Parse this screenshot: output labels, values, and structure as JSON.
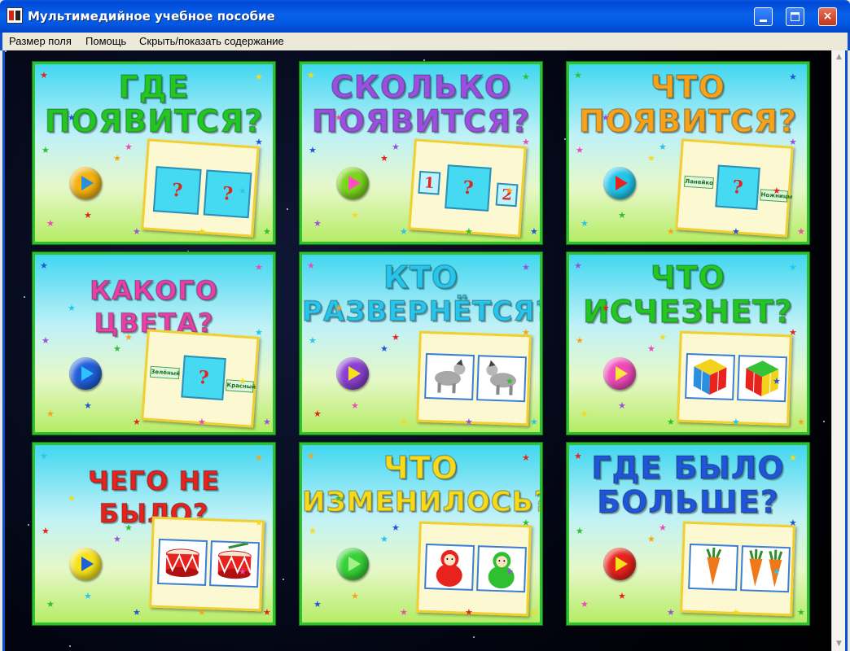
{
  "window": {
    "title": "Мультимедийное учебное пособие",
    "minimize_glyph": "",
    "maximize_glyph": "",
    "close_glyph": "×"
  },
  "menu": {
    "items": [
      "Размер поля",
      "Помощь",
      "Скрыть/показать содержание"
    ]
  },
  "cards": [
    {
      "line1": "ГДЕ",
      "line2": "ПОЯВИТСЯ?",
      "title_color": "#22c722",
      "play_color": "#f3b20f",
      "play_arrow": "#2a8fd8",
      "squares": [
        "?",
        "?"
      ]
    },
    {
      "line1": "СКОЛЬКО",
      "line2": "ПОЯВИТСЯ?",
      "title_color": "#9b4fe0",
      "play_color": "#7ad51c",
      "play_arrow": "#ff4fc0",
      "squares": [
        "1",
        "?",
        "2"
      ]
    },
    {
      "line1": "ЧТО",
      "line2": "ПОЯВИТСЯ?",
      "title_color": "#f7a21b",
      "play_color": "#21c6ea",
      "play_arrow": "#e8221c",
      "squares": [
        "?"
      ],
      "tags": [
        "Ланейко",
        "Ножницы"
      ]
    },
    {
      "line1": "КАКОГО ЦВЕТА?",
      "line2": "",
      "title_color": "#e83fa8",
      "play_color": "#1f5fd8",
      "play_arrow": "#2ec0ff",
      "squares": [
        "?"
      ],
      "tags": [
        "Зелёный",
        "Красный"
      ]
    },
    {
      "line1": "КТО",
      "line2": "РАЗВЕРНЁТСЯ?",
      "title_color": "#26c5ec",
      "play_color": "#8a3fd2",
      "play_arrow": "#f6e21b"
    },
    {
      "line1": "ЧТО",
      "line2": "ИСЧЕЗНЕТ?",
      "title_color": "#22c722",
      "play_color": "#f048b8",
      "play_arrow": "#f7e83a"
    },
    {
      "line1": "ЧЕГО НЕ БЫЛО?",
      "line2": "",
      "title_color": "#e8221c",
      "play_color": "#f6e21b",
      "play_arrow": "#1f5fd8"
    },
    {
      "line1": "ЧТО",
      "line2": "ИЗМЕНИЛОСЬ?",
      "title_color": "#f6da1b",
      "play_color": "#36d236",
      "play_arrow": "#a6f08a"
    },
    {
      "line1": "ГДЕ БЫЛО",
      "line2": "БОЛЬШЕ?",
      "title_color": "#1f55d8",
      "play_color": "#e8221c",
      "play_arrow": "#f6e21b"
    }
  ],
  "colors": {
    "titlebar": "#0a5adf",
    "card_border": "#2ec02e",
    "panel_border": "#f0d030"
  }
}
